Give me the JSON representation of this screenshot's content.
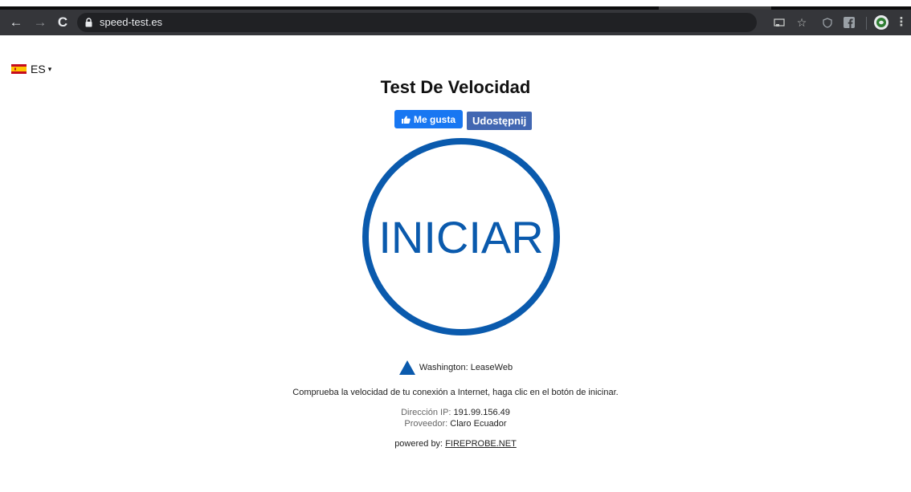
{
  "browser": {
    "url": "speed-test.es",
    "icons": {
      "back": "arrow-left",
      "forward": "arrow-right",
      "reload": "reload",
      "lock": "lock",
      "cast": "cast",
      "bookmark": "star",
      "extension_shield": "shield",
      "extension_facebook": "facebook",
      "profile": "avatar",
      "menu": "three-dots"
    }
  },
  "language": {
    "code": "ES",
    "caret": "▾",
    "flag": "spain-flag"
  },
  "header": {
    "title": "Test De Velocidad"
  },
  "social": {
    "like_label": "Me gusta",
    "share_label": "Udostępnij"
  },
  "start": {
    "label": "INICIAR",
    "color": "#0a5aad"
  },
  "server": {
    "name": "Washington: LeaseWeb"
  },
  "description": "Comprueba la velocidad de tu conexión a Internet, haga clic en el botón de inicinar.",
  "connection": {
    "ip_label": "Dirección IP:",
    "ip_value": "191.99.156.49",
    "isp_label": "Proveedor:",
    "isp_value": "Claro Ecuador"
  },
  "footer": {
    "powered_label": "powered by:",
    "powered_link": "FIREPROBE.NET"
  },
  "colors": {
    "brand_blue": "#0a5aad",
    "facebook_like": "#1877f2",
    "facebook_share": "#4267b2"
  }
}
